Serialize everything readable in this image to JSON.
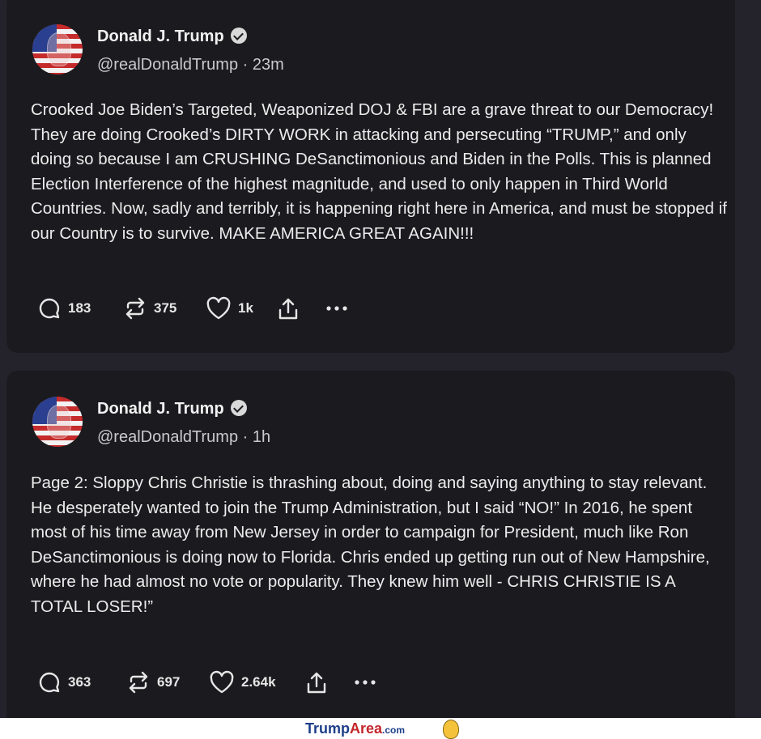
{
  "posts": [
    {
      "author": "Donald J. Trump",
      "handle_time": "@realDonaldTrump · 23m",
      "text": "Crooked Joe Biden’s Targeted, Weaponized DOJ & FBI are a grave threat to our Democracy! They are doing Crooked’s DIRTY WORK in attacking and persecuting “TRUMP,” and only doing so because I am CRUSHING DeSanctimonious and Biden in the Polls. This is planned Election Interference of the highest magnitude, and used to only happen in Third World Countries. Now, sadly and terribly, it is happening right here in America, and must be stopped if our Country is to survive. MAKE AMERICA GREAT AGAIN!!!",
      "replies": "183",
      "retruths": "375",
      "likes": "1k"
    },
    {
      "author": "Donald J. Trump",
      "handle_time": "@realDonaldTrump · 1h",
      "text": "Page 2: Sloppy Chris Christie is thrashing about, doing and saying anything to stay relevant. He desperately wanted to join the Trump Administration, but I said “NO!” In 2016, he spent most of his time away from New Jersey in order to campaign for President, much like Ron DeSanctimonious is doing now to Florida. Chris ended up getting run out of New Hampshire, where he had almost no vote or popularity. They knew him well - CHRIS CHRISTIE IS A TOTAL LOSER!”",
      "replies": "363",
      "retruths": "697",
      "likes": "2.64k"
    }
  ],
  "watermark": {
    "part1": "Trump",
    "part2": "Area",
    "part3": ".com"
  },
  "icons": [
    "verified-badge-icon",
    "reply-icon",
    "retruth-icon",
    "like-icon",
    "share-icon",
    "more-icon"
  ],
  "colors": {
    "background": "#24232c",
    "card": "#1b1b1f",
    "text": "#ececec",
    "logo_blue": "#1d3f8a",
    "logo_red": "#c3262b"
  }
}
